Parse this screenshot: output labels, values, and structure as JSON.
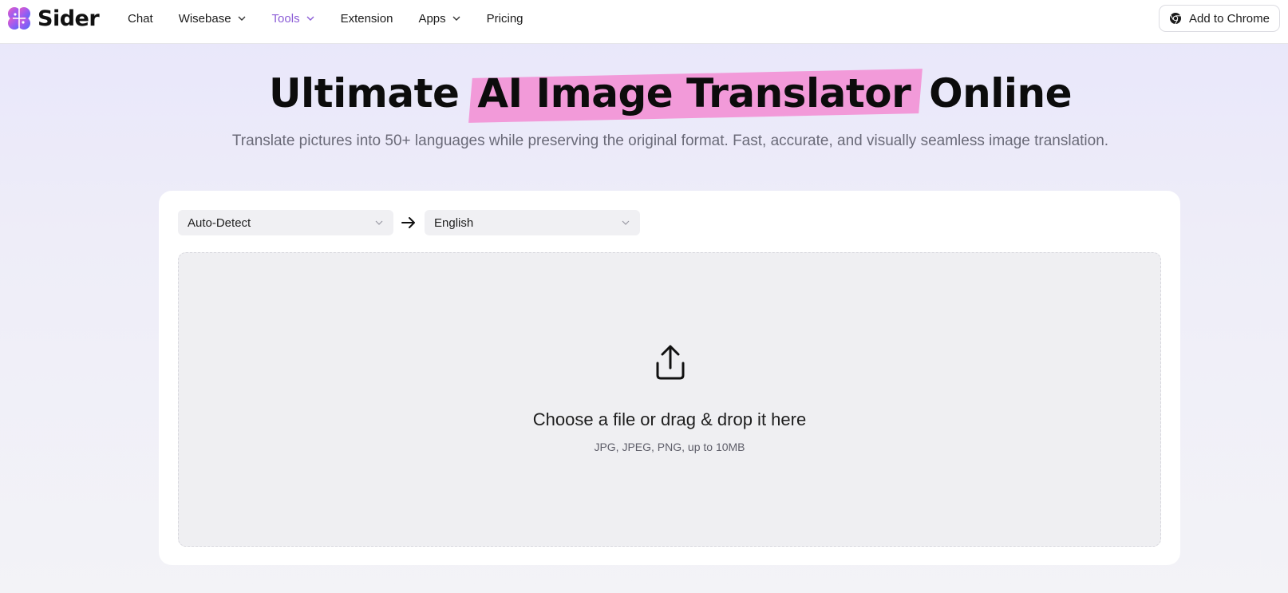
{
  "brand": {
    "name": "Sider"
  },
  "nav": {
    "items": [
      {
        "label": "Chat",
        "has_dropdown": false,
        "active": false
      },
      {
        "label": "Wisebase",
        "has_dropdown": true,
        "active": false
      },
      {
        "label": "Tools",
        "has_dropdown": true,
        "active": true
      },
      {
        "label": "Extension",
        "has_dropdown": false,
        "active": false
      },
      {
        "label": "Apps",
        "has_dropdown": true,
        "active": false
      },
      {
        "label": "Pricing",
        "has_dropdown": false,
        "active": false
      }
    ],
    "cta_label": "Add to Chrome",
    "cta_icon": "chrome-icon"
  },
  "hero": {
    "title_pre": "Ultimate",
    "title_highlight": "AI Image Translator",
    "title_post": "Online",
    "subtitle": "Translate pictures into 50+ languages while preserving the original format. Fast, accurate, and visually seamless image translation."
  },
  "translator": {
    "source_language": "Auto-Detect",
    "target_language": "English",
    "direction_icon": "arrow-right-icon",
    "upload": {
      "icon": "upload-icon",
      "title": "Choose a file or drag & drop it here",
      "hint": "JPG, JPEG, PNG, up to 10MB"
    }
  },
  "colors": {
    "accent": "#8b5cd6",
    "highlight": "#f29ad9",
    "page_bg_top": "#e8e6fb",
    "dropzone_bg": "#efeff2"
  }
}
